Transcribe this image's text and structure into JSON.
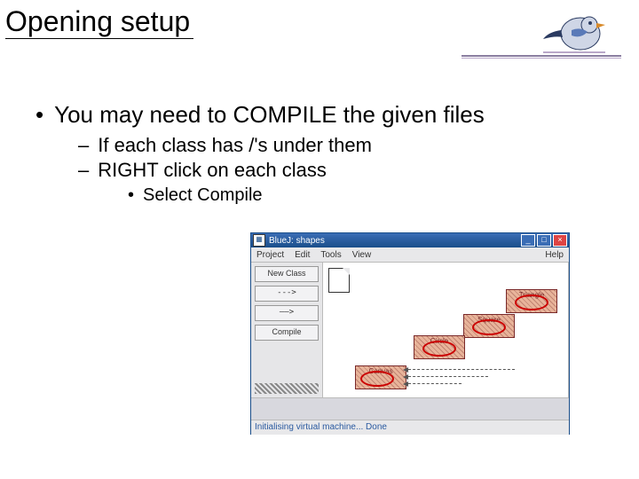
{
  "title": "Opening setup",
  "bullets": {
    "l1": "You may need to COMPILE the given files",
    "l2a": "If each class has /'s under them",
    "l2b": "RIGHT click on each class",
    "l3": "Select Compile"
  },
  "bluej": {
    "title": "BlueJ:  shapes",
    "menu": {
      "project": "Project",
      "edit": "Edit",
      "tools": "Tools",
      "view": "View",
      "help": "Help"
    },
    "side": {
      "newclass": "New Class",
      "dashed": "--->",
      "solid": "——>",
      "compile": "Compile"
    },
    "classes": {
      "triangle": "Triangle",
      "square": "Square",
      "circle": "Circle",
      "canvas": "Canvas"
    },
    "status": "Initialising virtual machine... Done"
  }
}
